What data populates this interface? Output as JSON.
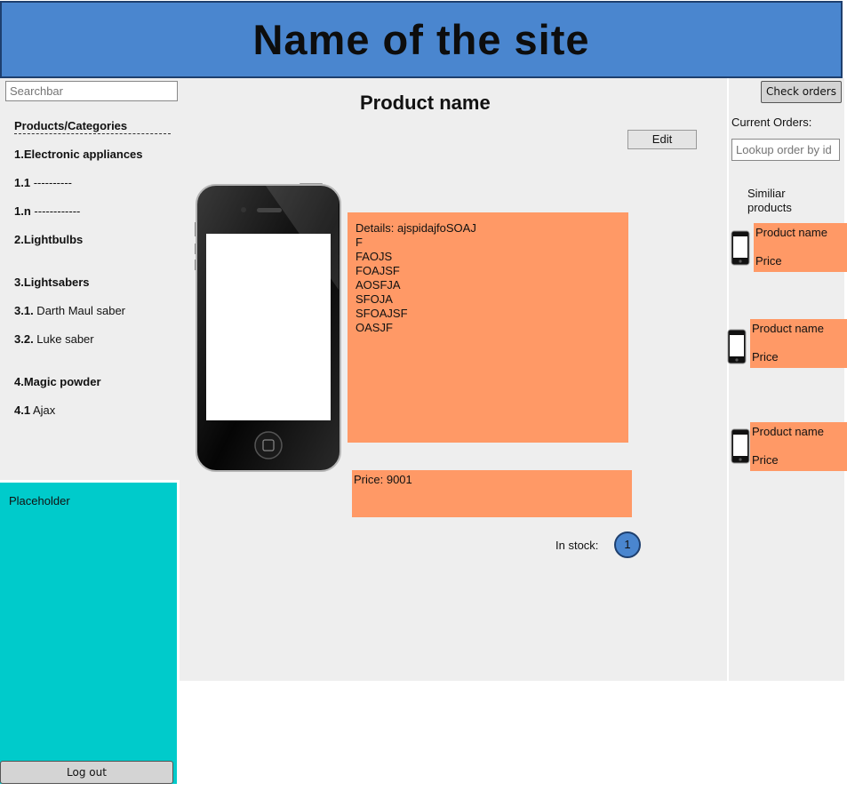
{
  "header": {
    "site_name": "Name of the site"
  },
  "sidebar": {
    "search_placeholder": "Searchbar",
    "categories_heading": "Products/Categories",
    "items": [
      {
        "num": "1.Electronic appliances",
        "text": ""
      },
      {
        "num": "1.1",
        "text": " ----------"
      },
      {
        "num": "1.n",
        "text": " ------------"
      },
      {
        "num": "2.Lightbulbs",
        "text": ""
      },
      {
        "num": "3.Lightsabers",
        "text": ""
      },
      {
        "num": "3.1.",
        "text": " Darth Maul saber"
      },
      {
        "num": "3.2.",
        "text": " Luke saber"
      },
      {
        "num": "4.Magic powder",
        "text": ""
      },
      {
        "num": "4.1",
        "text": " Ajax"
      }
    ],
    "placeholder_label": "Placeholder",
    "logout_label": "Log out"
  },
  "main": {
    "product_name": "Product name",
    "edit_label": "Edit",
    "details_lines": [
      "Details: ajspidajfoSOAJ",
      "F",
      "FAOJS",
      "FOAJSF",
      "AOSFJA",
      "SFOJA",
      "SFOAJSF",
      "OASJF"
    ],
    "price_text": "Price: 9001",
    "stock_label": "In stock:",
    "stock_value": "1"
  },
  "right": {
    "check_orders_label": "Check orders",
    "current_orders_label": "Current Orders:",
    "lookup_placeholder": "Lookup order by id",
    "similar_label": "Similiar products",
    "similar": [
      {
        "name": "Product name",
        "price": "Price"
      },
      {
        "name": "Product name",
        "price": "Price"
      },
      {
        "name": "Product name",
        "price": "Price"
      }
    ]
  },
  "colors": {
    "header": "#4a86cf",
    "panel": "#eeeeee",
    "accent": "#ff9966",
    "placeholder": "#00cbcb"
  }
}
